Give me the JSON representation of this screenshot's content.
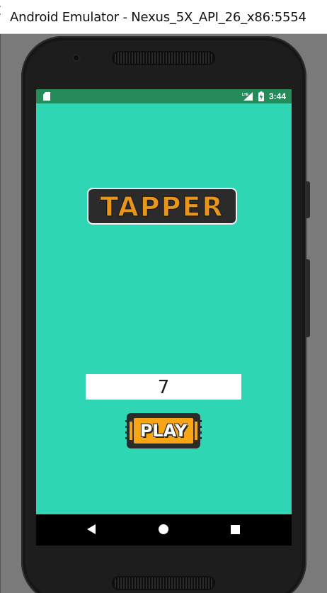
{
  "window": {
    "title": "Android Emulator - Nexus_5X_API_26_x86:5554"
  },
  "status_bar": {
    "time": "3:44",
    "icons": [
      "sd-card-icon",
      "lte-signal-icon",
      "battery-charging-icon"
    ]
  },
  "app": {
    "logo_text": "TAPPER",
    "score_value": "7",
    "play_label": "PLAY"
  },
  "nav_bar": {
    "icons": [
      "back-icon",
      "home-icon",
      "recents-icon"
    ]
  },
  "colors": {
    "screen_background": "#2fd6b4",
    "status_bar": "#258b58",
    "logo_fill": "#e8951c",
    "play_fill": "#f5a516",
    "outline": "#2b2b2b"
  }
}
